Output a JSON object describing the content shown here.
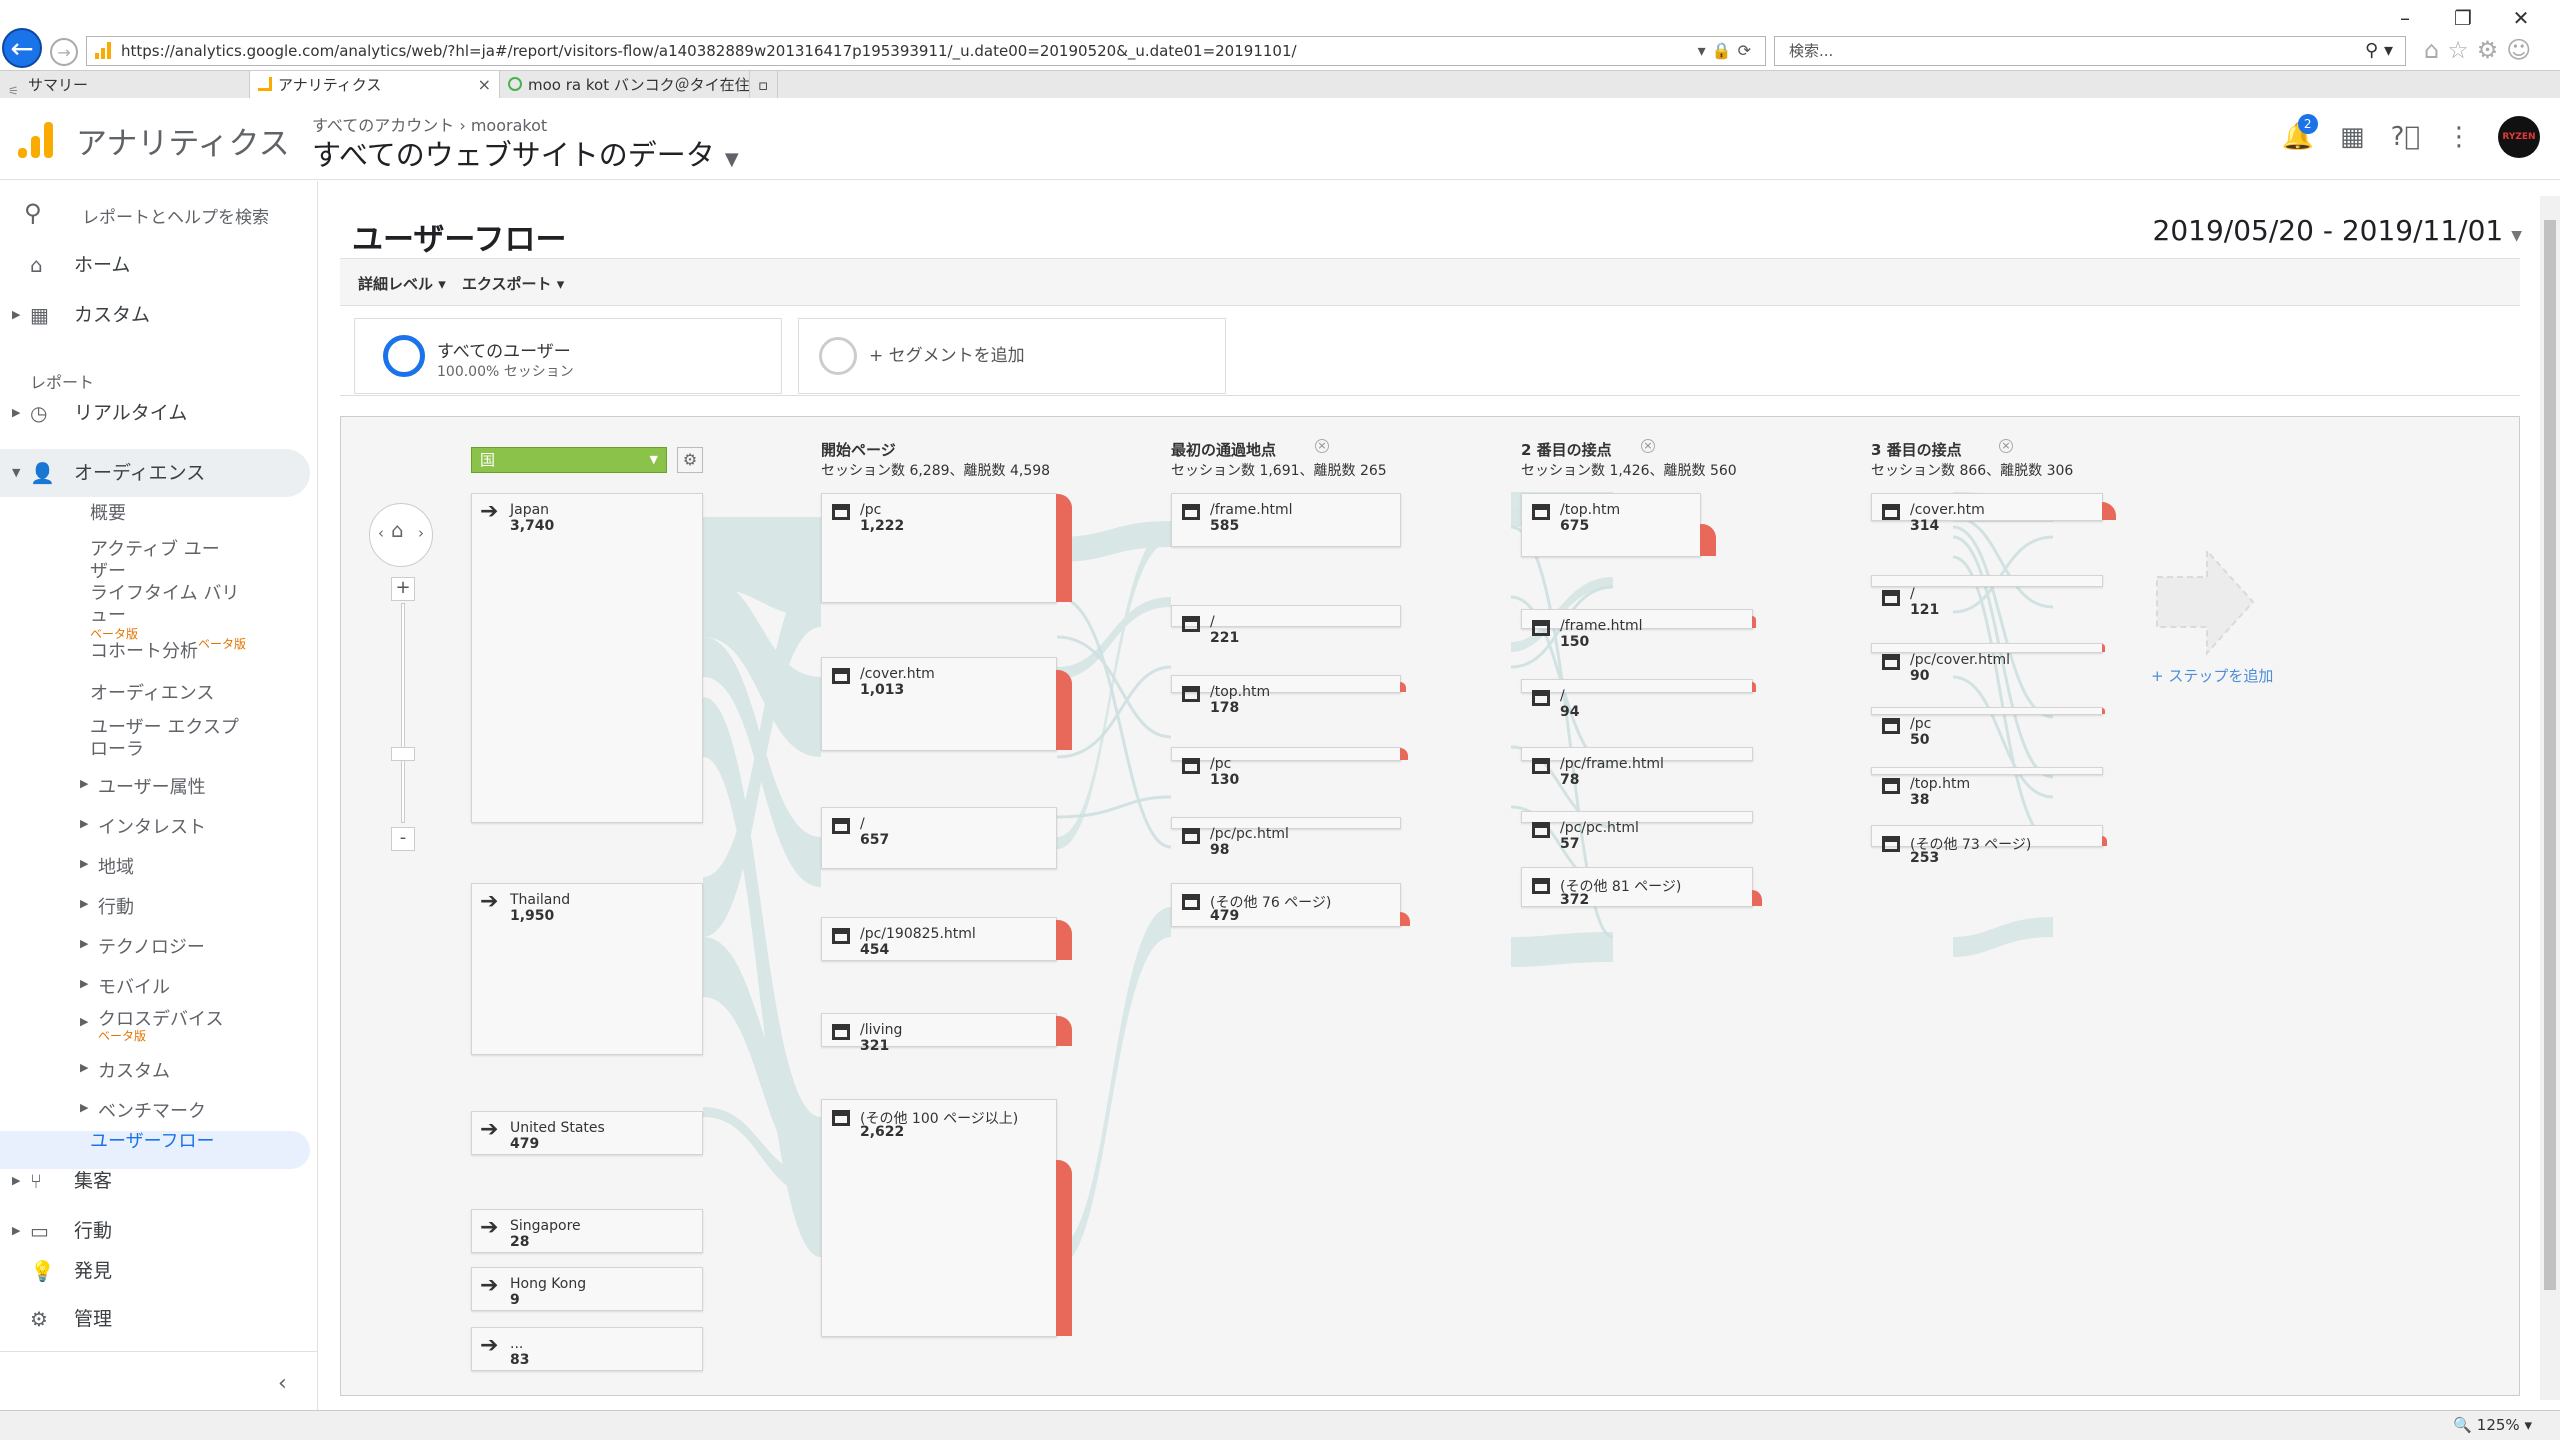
{
  "browser": {
    "url": "https://analytics.google.com/analytics/web/?hl=ja#/report/visitors-flow/a140382889w201316417p195393911/_u.date00=20190520&_u.date01=20191101/",
    "search_placeholder": "検索...",
    "tabs": [
      {
        "label": "サマリー"
      },
      {
        "label": "アナリティクス"
      },
      {
        "label": "moo ra kot バンコク＠タイ在住／..."
      }
    ],
    "zoom": "125%"
  },
  "header": {
    "app_name": "アナリティクス",
    "breadcrumb_root": "すべてのアカウント",
    "breadcrumb_sep": "›",
    "breadcrumb_account": "moorakot",
    "property": "すべてのウェブサイトのデータ",
    "notification_count": "2",
    "avatar_text": "RYZEN"
  },
  "sidebar": {
    "search_label": "レポートとヘルプを検索",
    "home": "ホーム",
    "custom": "カスタム",
    "reports_heading": "レポート",
    "realtime": "リアルタイム",
    "audience": "オーディエンス",
    "audience_items": [
      {
        "label": "概要"
      },
      {
        "label": "アクティブ ユーザー"
      },
      {
        "label": "ライフタイム バリュー",
        "beta": "ベータ版"
      },
      {
        "label": "コホート分析",
        "beta": "ベータ版"
      },
      {
        "label": "オーディエンス"
      },
      {
        "label": "ユーザー エクスプローラ"
      }
    ],
    "audience_groups": [
      "ユーザー属性",
      "インタレスト",
      "地域",
      "行動",
      "テクノロジー",
      "モバイル",
      "クロスデバイス",
      "カスタム",
      "ベンチマーク"
    ],
    "crossdevice_beta": "ベータ版",
    "user_flow": "ユーザーフロー",
    "acquisition": "集客",
    "behavior": "行動",
    "discover": "発見",
    "admin": "管理"
  },
  "report": {
    "title": "ユーザーフロー",
    "date_range": "2019/05/20 - 2019/11/01",
    "toolbar": {
      "detail": "詳細レベル",
      "export": "エクスポート"
    },
    "segment_all": {
      "name": "すべてのユーザー",
      "pct": "100.00% セッション"
    },
    "segment_add": "+ セグメントを追加",
    "dimension": "国",
    "add_step": "+ ステップを追加"
  },
  "flow": {
    "columns": [
      {
        "title": "開始ページ",
        "stats": "セッション数 6,289、離脱数 4,598",
        "closable": false
      },
      {
        "title": "最初の通過地点",
        "stats": "セッション数 1,691、離脱数 265",
        "closable": true
      },
      {
        "title": "2 番目の接点",
        "stats": "セッション数 1,426、離脱数 560",
        "closable": true
      },
      {
        "title": "3 番目の接点",
        "stats": "セッション数 866、離脱数 306",
        "closable": true
      }
    ],
    "countries": [
      {
        "label": "Japan",
        "value": "3,740"
      },
      {
        "label": "Thailand",
        "value": "1,950"
      },
      {
        "label": "United States",
        "value": "479"
      },
      {
        "label": "Singapore",
        "value": "28"
      },
      {
        "label": "Hong Kong",
        "value": "9"
      },
      {
        "label": "...",
        "value": "83"
      }
    ],
    "start_pages": [
      {
        "label": "/pc",
        "value": "1,222"
      },
      {
        "label": "/cover.htm",
        "value": "1,013"
      },
      {
        "label": "/",
        "value": "657"
      },
      {
        "label": "/pc/190825.html",
        "value": "454"
      },
      {
        "label": "/living",
        "value": "321"
      },
      {
        "label": "(その他 100 ページ以上)",
        "value": "2,622"
      }
    ],
    "step1": [
      {
        "label": "/frame.html",
        "value": "585"
      },
      {
        "label": "/",
        "value": "221"
      },
      {
        "label": "/top.htm",
        "value": "178"
      },
      {
        "label": "/pc",
        "value": "130"
      },
      {
        "label": "/pc/pc.html",
        "value": "98"
      },
      {
        "label": "(その他 76 ページ)",
        "value": "479"
      }
    ],
    "step2": [
      {
        "label": "/top.htm",
        "value": "675"
      },
      {
        "label": "/frame.html",
        "value": "150"
      },
      {
        "label": "/",
        "value": "94"
      },
      {
        "label": "/pc/frame.html",
        "value": "78"
      },
      {
        "label": "/pc/pc.html",
        "value": "57"
      },
      {
        "label": "(その他 81 ページ)",
        "value": "372"
      }
    ],
    "step3": [
      {
        "label": "/cover.htm",
        "value": "314"
      },
      {
        "label": "/",
        "value": "121"
      },
      {
        "label": "/pc/cover.html",
        "value": "90"
      },
      {
        "label": "/pc",
        "value": "50"
      },
      {
        "label": "/top.htm",
        "value": "38"
      },
      {
        "label": "(その他 73 ページ)",
        "value": "253"
      }
    ]
  },
  "colors": {
    "brand": "#f9ab00",
    "dropoff": "#e8685a",
    "flow": "#cfe0e0",
    "accent": "#1a73e8",
    "segment_ring": "#1a73e8"
  }
}
